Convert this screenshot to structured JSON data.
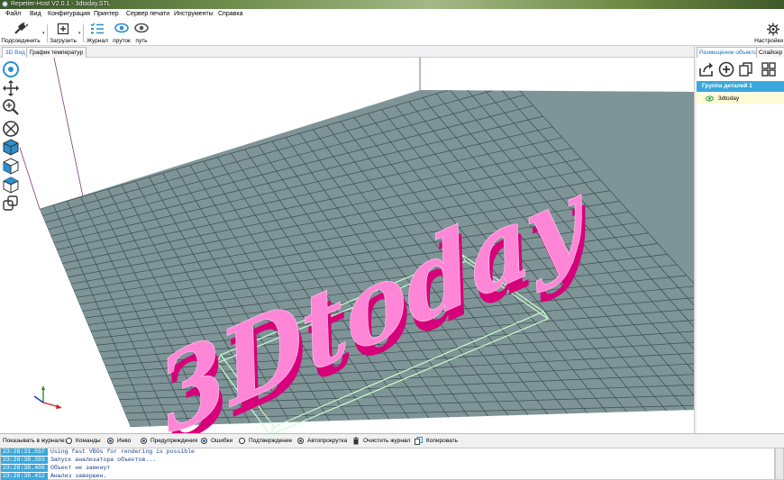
{
  "window": {
    "title": "Repetier-Host V2.0.1 - 3dtoday.STL"
  },
  "menu": [
    "Файл",
    "Вид",
    "Конфигурация",
    "Принтер",
    "Сервер печати",
    "Инструменты",
    "Справка"
  ],
  "toolbar": {
    "connect": "Подсоединить",
    "load": "Загрузить",
    "journal": "Журнал",
    "filament": "пруток",
    "path": "путь",
    "settings": "Настройки"
  },
  "tabs": [
    "3D Вид",
    "График температур"
  ],
  "right_panel": {
    "tabs": [
      "Размещение объекта",
      "Слайсер"
    ],
    "group": "Группа деталей 1",
    "object": "3dtoday"
  },
  "log": {
    "show_label": "Показывать в журнале:",
    "options": [
      {
        "label": "Команды",
        "checked": false
      },
      {
        "label": "Инво",
        "checked": true
      },
      {
        "label": "Предупреждения",
        "checked": true
      },
      {
        "label": "Ошибки",
        "checked": true
      },
      {
        "label": "Подтверждение",
        "checked": false
      },
      {
        "label": "Автопрокрутка",
        "checked": true
      }
    ],
    "clear": "Очистить журнал",
    "copy": "Копировать",
    "lines": [
      {
        "time": "23:28:31.557",
        "message": "Using fast VBOs for rendering is possible"
      },
      {
        "time": "23:28:38.393",
        "message": "Запуск анализатора объектов..."
      },
      {
        "time": "23:28:38.406",
        "message": "Объект не замкнут"
      },
      {
        "time": "23:28:38.412",
        "message": "Анализ завершен."
      }
    ]
  },
  "scene": {
    "model_text": "3Dtoday",
    "model_color": "#ff7fd4",
    "model_side_color": "#d6007a",
    "bed_color": "#7f9497",
    "box_color": "#c8ffcc"
  },
  "colors": {
    "accent": "#3aa8dc"
  }
}
